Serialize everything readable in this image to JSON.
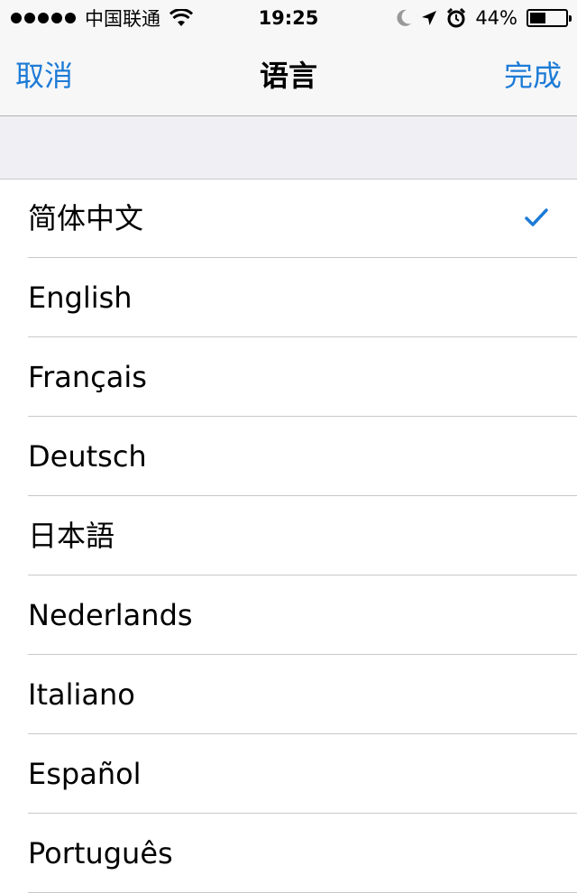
{
  "status_bar": {
    "carrier": "中国联通",
    "time": "19:25",
    "battery_percent": "44%",
    "battery_level": 0.44,
    "icons": [
      "signal-dots-icon",
      "wifi-icon",
      "moon-icon",
      "location-arrow-icon",
      "alarm-icon",
      "battery-icon"
    ]
  },
  "nav": {
    "cancel_label": "取消",
    "title": "语言",
    "done_label": "完成"
  },
  "accent_color": "#1d7bd6",
  "languages": [
    {
      "label": "简体中文",
      "selected": true
    },
    {
      "label": "English",
      "selected": false
    },
    {
      "label": "Français",
      "selected": false
    },
    {
      "label": "Deutsch",
      "selected": false
    },
    {
      "label": "日本語",
      "selected": false
    },
    {
      "label": "Nederlands",
      "selected": false
    },
    {
      "label": "Italiano",
      "selected": false
    },
    {
      "label": "Español",
      "selected": false
    },
    {
      "label": "Português",
      "selected": false
    }
  ]
}
